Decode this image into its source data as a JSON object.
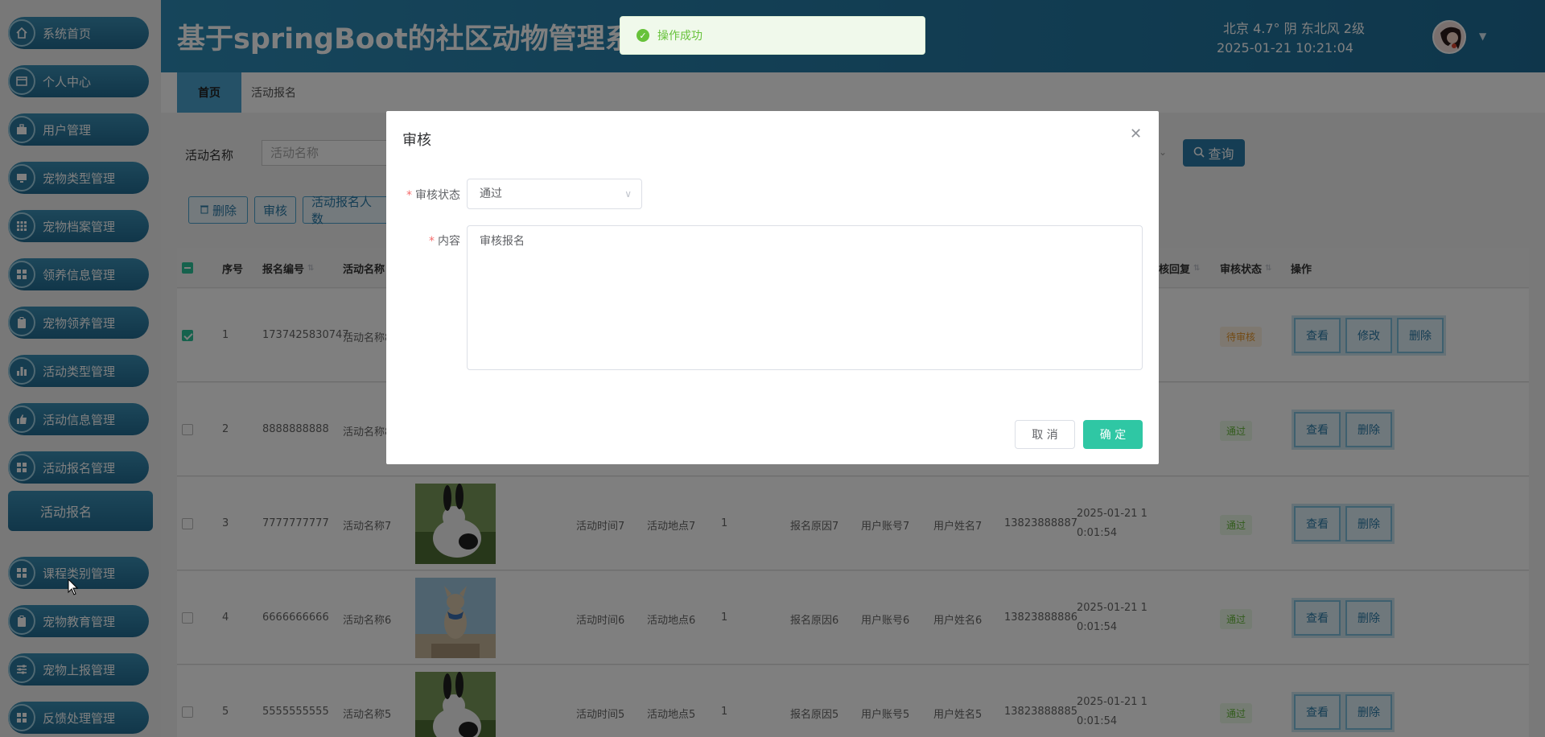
{
  "header": {
    "title": "基于springBoot的社区动物管理系",
    "weather": "北京  4.7°  阴  东北风  2级",
    "datetime": "2025-01-21 10:21:04"
  },
  "sidebar": {
    "items": [
      {
        "label": "系统首页",
        "icon": "home-icon"
      },
      {
        "label": "个人中心",
        "icon": "card-icon"
      },
      {
        "label": "用户管理",
        "icon": "briefcase-icon"
      },
      {
        "label": "宠物类型管理",
        "icon": "monitor-icon"
      },
      {
        "label": "宠物档案管理",
        "icon": "grid-icon"
      },
      {
        "label": "领养信息管理",
        "icon": "apps-icon"
      },
      {
        "label": "宠物领养管理",
        "icon": "clipboard-icon"
      },
      {
        "label": "活动类型管理",
        "icon": "bar-chart-icon"
      },
      {
        "label": "活动信息管理",
        "icon": "thumbs-up-icon"
      },
      {
        "label": "活动报名管理",
        "icon": "apps-icon"
      },
      {
        "label": "课程类别管理",
        "icon": "apps-icon"
      },
      {
        "label": "宠物教育管理",
        "icon": "clipboard-icon"
      },
      {
        "label": "宠物上报管理",
        "icon": "sliders-icon"
      },
      {
        "label": "反馈处理管理",
        "icon": "apps-icon"
      }
    ],
    "sub_item": "活动报名"
  },
  "tabs": [
    {
      "label": "首页"
    },
    {
      "label": "活动报名"
    }
  ],
  "search": {
    "label": "活动名称",
    "placeholder": "活动名称",
    "query_label": "查询"
  },
  "actions": {
    "delete_label": "删除",
    "audit_label": "审核",
    "count_label": "活动报名人数"
  },
  "table": {
    "columns": [
      "序号",
      "报名编号",
      "活动名称",
      "核回复",
      "审核状态",
      "操作"
    ],
    "rows": [
      {
        "no": "1",
        "code": "1737425830747",
        "activity": "活动名称8",
        "status": "待审核",
        "status_type": "pending",
        "buttons": [
          "查看",
          "修改",
          "删除"
        ],
        "checked": true
      },
      {
        "no": "2",
        "code": "8888888888",
        "activity": "活动名称8",
        "status": "通过",
        "status_type": "pass",
        "buttons": [
          "查看",
          "删除"
        ],
        "checked": false
      },
      {
        "no": "3",
        "code": "7777777777",
        "activity": "活动名称7",
        "time": "活动时间7",
        "place": "活动地点7",
        "count": "1",
        "reason": "报名原因7",
        "account": "用户账号7",
        "name": "用户姓名7",
        "phone": "13823888887",
        "date1": "2025-01-21 1",
        "date2": "0:01:54",
        "status": "通过",
        "status_type": "pass",
        "buttons": [
          "查看",
          "删除"
        ],
        "checked": false
      },
      {
        "no": "4",
        "code": "6666666666",
        "activity": "活动名称6",
        "time": "活动时间6",
        "place": "活动地点6",
        "count": "1",
        "reason": "报名原因6",
        "account": "用户账号6",
        "name": "用户姓名6",
        "phone": "13823888886",
        "date1": "2025-01-21 1",
        "date2": "0:01:54",
        "status": "通过",
        "status_type": "pass",
        "buttons": [
          "查看",
          "删除"
        ],
        "checked": false
      },
      {
        "no": "5",
        "code": "5555555555",
        "activity": "活动名称5",
        "time": "活动时间5",
        "place": "活动地点5",
        "count": "1",
        "reason": "报名原因5",
        "account": "用户账号5",
        "name": "用户姓名5",
        "phone": "13823888885",
        "date1": "2025-01-21 1",
        "date2": "0:01:54",
        "status": "通过",
        "status_type": "pass",
        "buttons": [
          "查看",
          "删除"
        ],
        "checked": false
      }
    ]
  },
  "dialog": {
    "title": "审核",
    "status_label": "审核状态",
    "status_value": "通过",
    "content_label": "内容",
    "content_value": "审核报名",
    "cancel_label": "取 消",
    "ok_label": "确 定"
  },
  "toast": {
    "text": "操作成功"
  },
  "colors": {
    "header": "#1e6d97",
    "accent": "#2fc7a4",
    "success": "#67c23a"
  }
}
